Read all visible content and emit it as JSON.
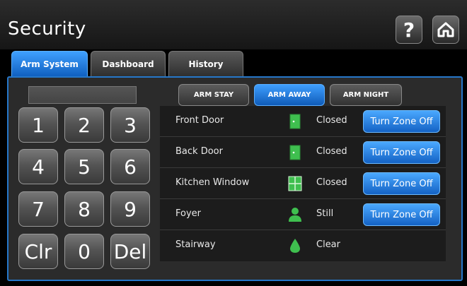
{
  "header": {
    "title": "Security",
    "help_label": "?"
  },
  "tabs": [
    {
      "label": "Arm System",
      "active": true
    },
    {
      "label": "Dashboard",
      "active": false
    },
    {
      "label": "History",
      "active": false
    }
  ],
  "keypad": {
    "display_value": "",
    "keys": [
      "1",
      "2",
      "3",
      "4",
      "5",
      "6",
      "7",
      "8",
      "9",
      "Clr",
      "0",
      "Del"
    ]
  },
  "arm_modes": [
    {
      "label": "ARM STAY",
      "active": false
    },
    {
      "label": "ARM AWAY",
      "active": true
    },
    {
      "label": "ARM NIGHT",
      "active": false
    }
  ],
  "zones": [
    {
      "name": "Front Door",
      "icon": "door-icon",
      "status": "Closed",
      "action": "Turn Zone Off"
    },
    {
      "name": "Back Door",
      "icon": "door-icon",
      "status": "Closed",
      "action": "Turn Zone Off"
    },
    {
      "name": "Kitchen Window",
      "icon": "window-icon",
      "status": "Closed",
      "action": "Turn Zone Off"
    },
    {
      "name": "Foyer",
      "icon": "motion-person-icon",
      "status": "Still",
      "action": "Turn Zone Off"
    },
    {
      "name": "Stairway",
      "icon": "water-drop-icon",
      "status": "Clear",
      "action": ""
    }
  ],
  "colors": {
    "accent": "#2677c9",
    "active_button": "#1f7ae0",
    "zone_icon_green": "#3fbf4f"
  }
}
